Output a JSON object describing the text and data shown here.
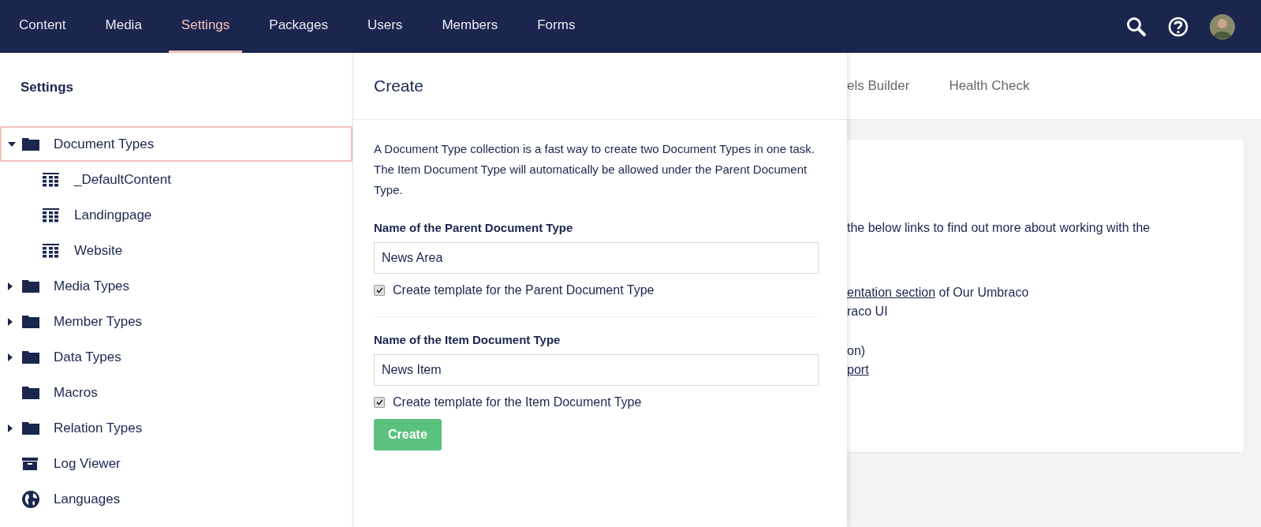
{
  "top_nav": {
    "sections": [
      {
        "label": "Content",
        "selected": false
      },
      {
        "label": "Media",
        "selected": false
      },
      {
        "label": "Settings",
        "selected": true
      },
      {
        "label": "Packages",
        "selected": false
      },
      {
        "label": "Users",
        "selected": false
      },
      {
        "label": "Members",
        "selected": false
      },
      {
        "label": "Forms",
        "selected": false
      }
    ]
  },
  "sidebar": {
    "title": "Settings",
    "tree": [
      {
        "label": "Document Types",
        "kind": "folder",
        "has_children": true,
        "expanded": true,
        "selected": true,
        "children": [
          {
            "label": "_DefaultContent",
            "kind": "doctype",
            "has_children": false,
            "selected": false
          },
          {
            "label": "Landingpage",
            "kind": "doctype",
            "has_children": false,
            "selected": false
          },
          {
            "label": "Website",
            "kind": "doctype",
            "has_children": false,
            "selected": false
          }
        ]
      },
      {
        "label": "Media Types",
        "kind": "folder",
        "has_children": true,
        "expanded": false,
        "selected": false
      },
      {
        "label": "Member Types",
        "kind": "folder",
        "has_children": true,
        "expanded": false,
        "selected": false
      },
      {
        "label": "Data Types",
        "kind": "folder",
        "has_children": true,
        "expanded": false,
        "selected": false
      },
      {
        "label": "Macros",
        "kind": "folder",
        "has_children": false,
        "selected": false
      },
      {
        "label": "Relation Types",
        "kind": "folder",
        "has_children": true,
        "expanded": false,
        "selected": false
      },
      {
        "label": "Log Viewer",
        "kind": "archive",
        "has_children": false,
        "selected": false
      },
      {
        "label": "Languages",
        "kind": "globe",
        "has_children": false,
        "selected": false
      }
    ]
  },
  "create_panel": {
    "title": "Create",
    "description": "A Document Type collection is a fast way to create two Document Types in one task. The Item Document Type will automatically be allowed under the Parent Document Type.",
    "groups": [
      {
        "label": "Name of the Parent Document Type",
        "value": "News Area",
        "checkbox": {
          "label": "Create template for the Parent Document Type",
          "checked": true
        }
      },
      {
        "label": "Name of the Item Document Type",
        "value": "News Item",
        "checkbox": {
          "label": "Create template for the Item Document Type",
          "checked": true
        }
      }
    ],
    "button": "Create"
  },
  "background": {
    "tabs": [
      "els Builder",
      "Health Check"
    ],
    "card": {
      "lines": [
        {
          "segments": [
            {
              "text": "the below links to find out more about working with the",
              "link": false
            }
          ]
        },
        {
          "segments": [
            {
              "text": "entation section",
              "link": true
            },
            {
              "text": " of Our Umbraco",
              "link": false
            }
          ]
        },
        {
          "segments": [
            {
              "text": "raco UI",
              "link": false
            }
          ]
        },
        {
          "segments": [
            {
              "text": "on)",
              "link": false
            }
          ]
        },
        {
          "segments": [
            {
              "text": "port",
              "link": true
            }
          ]
        }
      ]
    }
  }
}
